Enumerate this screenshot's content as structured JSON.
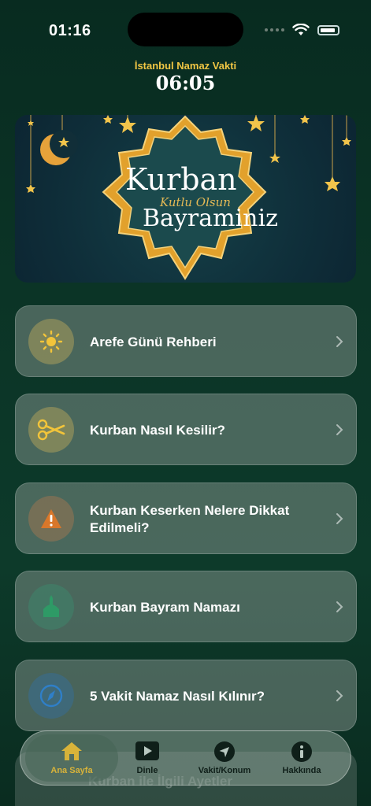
{
  "status_bar": {
    "time": "01:16"
  },
  "prayer": {
    "title": "İstanbul Namaz Vakti",
    "time": "06:05"
  },
  "banner": {
    "line1": "Kurban",
    "line2": "Kutlu Olsun",
    "line3": "Bayraminiz"
  },
  "menu": {
    "items": [
      {
        "label": "Arefe Günü Rehberi",
        "icon": "sun-icon",
        "color": "#f2c43a"
      },
      {
        "label": "Kurban Nasıl Kesilir?",
        "icon": "scissors-icon",
        "color": "#f2c43a"
      },
      {
        "label": "Kurban Keserken Nelere Dikkat Edilmeli?",
        "icon": "warning-icon",
        "color": "#e07a2b"
      },
      {
        "label": "Kurban Bayram Namazı",
        "icon": "mosque-icon",
        "color": "#2e9a66"
      },
      {
        "label": "5 Vakit Namaz Nasıl Kılınır?",
        "icon": "compass-icon",
        "color": "#2f7fc8"
      }
    ],
    "partial_item": "Kurban ile İlgili Ayetler"
  },
  "tabbar": {
    "tabs": [
      {
        "label": "Ana Sayfa",
        "icon": "home-icon",
        "active": true
      },
      {
        "label": "Dinle",
        "icon": "play-icon",
        "active": false
      },
      {
        "label": "Vakit/Konum",
        "icon": "location-arrow-icon",
        "active": false
      },
      {
        "label": "Hakkında",
        "icon": "info-icon",
        "active": false
      }
    ]
  },
  "colors": {
    "accent_gold": "#f1c644",
    "background": "#0b3426"
  }
}
